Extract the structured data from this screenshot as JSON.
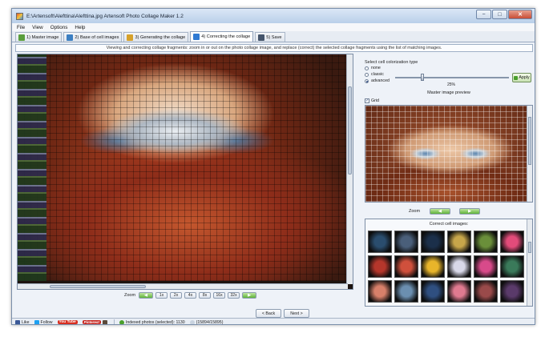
{
  "window": {
    "title": "E:\\Artensoft\\Alefttina\\Alefttina.jpg Artensoft Photo Collage Maker 1.2",
    "controls": [
      "−",
      "□",
      "✕"
    ]
  },
  "menu": [
    "File",
    "View",
    "Options",
    "Help"
  ],
  "tabs": [
    {
      "label": "1) Master image",
      "icon": "image-icon",
      "color": "#5a9e3c"
    },
    {
      "label": "2) Base of cell images",
      "icon": "download-icon",
      "color": "#3c7fc2"
    },
    {
      "label": "3) Generating the collage",
      "icon": "magic-wand-icon",
      "color": "#d6a12a"
    },
    {
      "label": "4) Correcting the collage",
      "icon": "cube-icon",
      "color": "#2f7ad3",
      "active": true
    },
    {
      "label": "5) Save",
      "icon": "floppy-disk-icon",
      "color": "#44546b"
    }
  ],
  "instruction": "Viewing and correcting collage fragments: zoom in or out on the photo collage image, and replace (correct) the selected collage fragments using the list of matching images.",
  "zoom": {
    "label": "Zoom",
    "levels": [
      "1x",
      "2x",
      "4x",
      "8x",
      "16x",
      "32x"
    ]
  },
  "nav": {
    "back": "< Back",
    "next": "Next >"
  },
  "colorization": {
    "title": "Select cell colorization type",
    "options": [
      "none",
      "classic",
      "advanced"
    ],
    "selected": "advanced",
    "slider_value": "25%",
    "apply_label": "Apply"
  },
  "preview": {
    "title": "Master image preview",
    "grid_label": "Grid",
    "grid_checked": true,
    "zoom_label": "Zoom"
  },
  "cells": {
    "title": "Correct cell images:",
    "colors": [
      "#2a4d6e",
      "#4a5f7a",
      "#1b2f4a",
      "#c7a64a",
      "#6a8f3a",
      "#e24b7a",
      "#b5362b",
      "#d0503c",
      "#e8b52a",
      "#d8d8e8",
      "#d84a8a",
      "#3a7a5a",
      "#d8806a",
      "#6b8fb0",
      "#2f4f80",
      "#e07a90",
      "#9a4a4a",
      "#5a3a6a"
    ]
  },
  "status": {
    "facebook": "Like",
    "twitter": "Follow",
    "youtube": "You Tube",
    "pinterest": "Pinterest",
    "indexed": "Indexed photos (selected): 1130",
    "count": "(15894/15895)"
  }
}
